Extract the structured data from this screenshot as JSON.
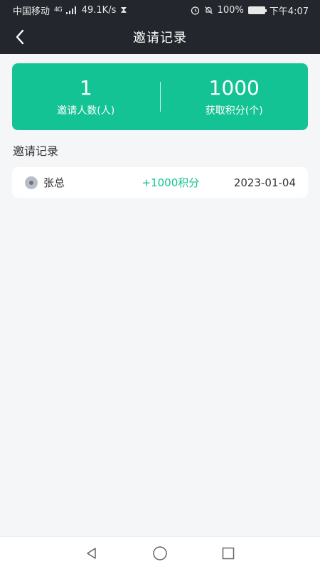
{
  "status_bar": {
    "carrier": "中国移动",
    "network": "4G",
    "speed": "49.1K/s",
    "battery": "100%",
    "time": "下午4:07"
  },
  "header": {
    "title": "邀请记录",
    "back_icon": "chevron-left-icon"
  },
  "stats": {
    "invited_value": "1",
    "invited_label": "邀请人数(人)",
    "points_value": "1000",
    "points_label": "获取积分(个)"
  },
  "section": {
    "title": "邀请记录"
  },
  "records": [
    {
      "name": "张总",
      "points": "+1000积分",
      "date": "2023-01-04"
    }
  ],
  "nav": {
    "back": "triangle-back-icon",
    "home": "circle-home-icon",
    "recent": "square-recent-icon"
  },
  "colors": {
    "accent": "#14c393",
    "header_bg": "#23262c",
    "page_bg": "#f5f6f8"
  }
}
